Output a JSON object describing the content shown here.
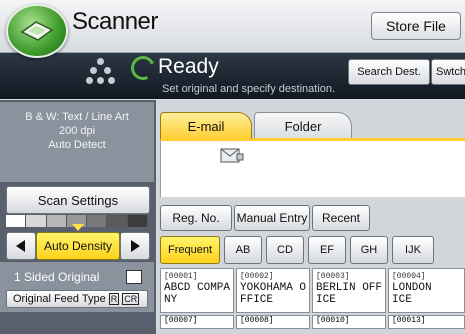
{
  "header": {
    "title": "Scanner",
    "store_file": "Store File"
  },
  "status": {
    "text": "Ready",
    "hint": "Set original and specify destination.",
    "search_dest": "Search Dest.",
    "switch": "Swtch"
  },
  "left": {
    "mode_line1": "B & W: Text / Line Art",
    "mode_line2": "200 dpi",
    "mode_line3": "Auto Detect",
    "scan_settings": "Scan Settings",
    "auto_density": "Auto Density",
    "sided_original": "1 Sided Original",
    "feed_type": "Original Feed Type",
    "feed_icon1": "R",
    "feed_icon2": "CR"
  },
  "tabs": {
    "email": "E-mail",
    "folder": "Folder"
  },
  "dest_buttons": {
    "reg_no": "Reg. No.",
    "manual_entry": "Manual Entry",
    "recent": "Recent"
  },
  "index_tabs": [
    "Frequent",
    "AB",
    "CD",
    "EF",
    "GH",
    "IJK"
  ],
  "addresses": [
    {
      "num": "[00001]",
      "line1": "ABCD COMPA",
      "line2": "NY"
    },
    {
      "num": "[00002]",
      "line1": "YOKOHAMA O",
      "line2": "FFICE"
    },
    {
      "num": "[00003]",
      "line1": "BERLIN OFF",
      "line2": "ICE"
    },
    {
      "num": "[00004]",
      "line1": "LONDON",
      "line2": "ICE"
    }
  ],
  "addresses_row2": [
    "[00007]",
    "[00008]",
    "[00010]",
    "[00013]"
  ],
  "colors": {
    "accent": "#ffcf33",
    "status_bg": "#101821",
    "ready_green": "#58b84a"
  }
}
